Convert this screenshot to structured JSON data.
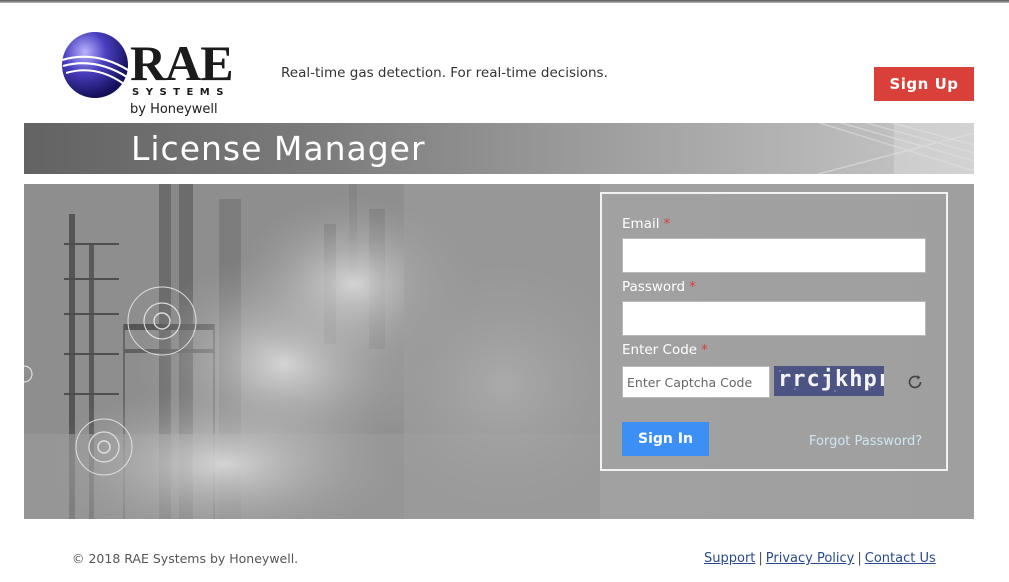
{
  "header": {
    "logo": {
      "wordmark": "RAE",
      "systems": "SYSTEMS",
      "byline": "by Honeywell",
      "icon": "globe-logo-icon"
    },
    "tagline": "Real-time gas detection. For real-time decisions.",
    "signup_label": "Sign Up",
    "signup_color": "#d9403a"
  },
  "band": {
    "title": "License Manager"
  },
  "form": {
    "email_label": "Email",
    "password_label": "Password",
    "code_label": "Enter Code",
    "required_mark": "*",
    "email_value": "",
    "password_value": "",
    "captcha_placeholder": "Enter Captcha Code",
    "captcha_text": "rrcjkhpr",
    "refresh_icon": "refresh-icon",
    "signin_label": "Sign In",
    "signin_color": "#3c8ff5",
    "forgot_label": "Forgot Password?"
  },
  "footer": {
    "copyright": "© 2018 RAE Systems by Honeywell.",
    "links": [
      "Support",
      "Privacy Policy",
      "Contact Us"
    ],
    "separator": "|"
  }
}
